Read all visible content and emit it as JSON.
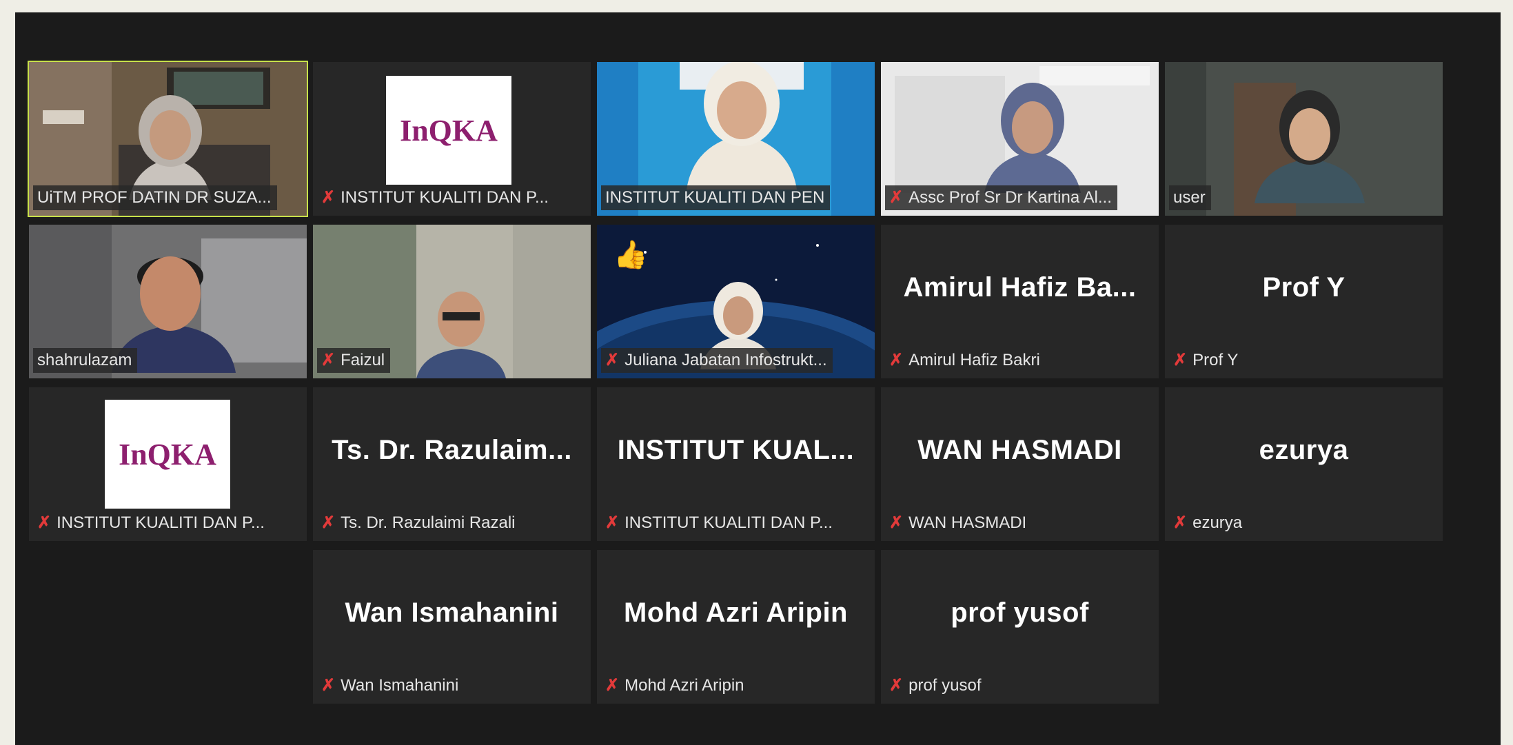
{
  "participants": [
    {
      "label": "UiTM PROF DATIN DR SUZA...",
      "muted": false
    },
    {
      "label": "INSTITUT KUALITI DAN P...",
      "muted": true,
      "logo": "InQKA"
    },
    {
      "label": "INSTITUT KUALITI DAN PEN",
      "muted": false
    },
    {
      "label": "Assc Prof Sr Dr Kartina Al...",
      "muted": true
    },
    {
      "label": "user",
      "muted": false
    },
    {
      "label": "shahrulazam",
      "muted": false
    },
    {
      "label": "Faizul",
      "muted": true
    },
    {
      "label": "Juliana Jabatan Infostrukt...",
      "muted": true,
      "reaction": "👍"
    },
    {
      "label": "Amirul Hafiz Bakri",
      "muted": true,
      "display_name": "Amirul Hafiz Ba..."
    },
    {
      "label": "Prof Y",
      "muted": true,
      "display_name": "Prof Y"
    },
    {
      "label": "INSTITUT KUALITI DAN P...",
      "muted": true,
      "logo": "InQKA"
    },
    {
      "label": "Ts. Dr. Razulaimi Razali",
      "muted": true,
      "display_name": "Ts. Dr. Razulaim..."
    },
    {
      "label": "INSTITUT KUALITI DAN P...",
      "muted": true,
      "display_name": "INSTITUT KUAL..."
    },
    {
      "label": "WAN HASMADI",
      "muted": true,
      "display_name": "WAN HASMADI"
    },
    {
      "label": "ezurya",
      "muted": true,
      "display_name": "ezurya"
    },
    {
      "label": "Wan Ismahanini",
      "muted": true,
      "display_name": "Wan Ismahanini"
    },
    {
      "label": "Mohd Azri Aripin",
      "muted": true,
      "display_name": "Mohd Azri Aripin"
    },
    {
      "label": "prof yusof",
      "muted": true,
      "display_name": "prof yusof"
    }
  ],
  "icons": {
    "muted_mic": "muted-mic-icon"
  },
  "colors": {
    "active_speaker": "#c8e14a",
    "muted": "#e23a3a",
    "tile_bg": "#272727"
  }
}
